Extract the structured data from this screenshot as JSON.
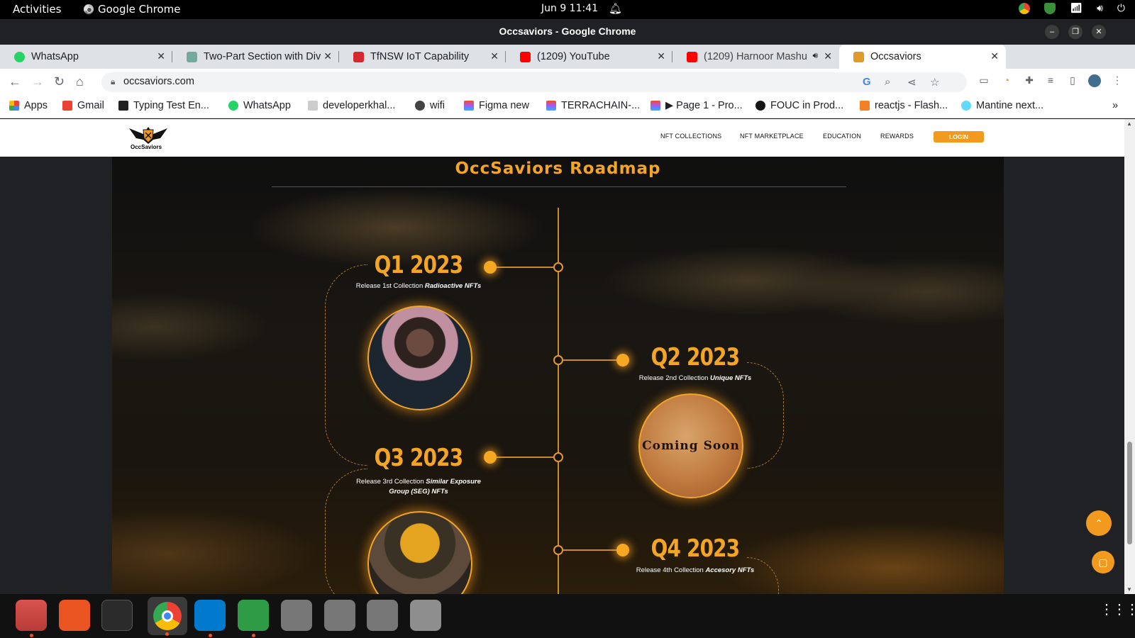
{
  "topbar": {
    "activities": "Activities",
    "app_name": "Google Chrome",
    "clock": "Jun 9  11:41"
  },
  "window": {
    "title": "Occsaviors - Google Chrome"
  },
  "tabs": [
    {
      "label": "WhatsApp",
      "color": "#25d366"
    },
    {
      "label": "Two-Part Section with Div",
      "color": "#74aa9c"
    },
    {
      "label": "TfNSW IoT Capability",
      "color": "#d7282f"
    },
    {
      "label": "(1209) YouTube",
      "color": "#ff0000"
    },
    {
      "label": "(1209) Harnoor Mashu",
      "color": "#ff0000"
    },
    {
      "label": "Occsaviors",
      "color": "#e09a2a"
    }
  ],
  "address": {
    "url": "occsaviors.com"
  },
  "bookmarks": [
    {
      "label": "Apps",
      "color": "#ea4335"
    },
    {
      "label": "Gmail",
      "color": "#ea4335"
    },
    {
      "label": "Typing Test En...",
      "color": "#222222"
    },
    {
      "label": "WhatsApp",
      "color": "#25d366"
    },
    {
      "label": "developerkhal...",
      "color": "#666666"
    },
    {
      "label": "wifi",
      "color": "#444444"
    },
    {
      "label": "Figma new",
      "color": "#f24e1e"
    },
    {
      "label": "TERRACHAIN-...",
      "color": "#f24e1e"
    },
    {
      "label": "▶ Page 1 - Pro...",
      "color": "#a259ff"
    },
    {
      "label": "FOUC in Prod...",
      "color": "#181717"
    },
    {
      "label": "reactjs - Flash...",
      "color": "#f48024"
    },
    {
      "label": "Mantine next...",
      "color": "#61dafb"
    }
  ],
  "site": {
    "logo_text": "OccSaviors",
    "nav": [
      "NFT COLLECTIONS",
      "NFT MARKETPLACE",
      "EDUCATION",
      "REWARDS"
    ],
    "login": "LOGIN",
    "heading": "OccSaviors Roadmap",
    "milestones": [
      {
        "quarter": "Q1 2023",
        "desc_plain": "Release 1st Collection ",
        "desc_bold": "Radioactive NFTs"
      },
      {
        "quarter": "Q2 2023",
        "desc_plain": "Release 2nd Collection ",
        "desc_bold": "Unique NFTs",
        "image_text": "Coming Soon"
      },
      {
        "quarter": "Q3 2023",
        "desc_plain": "Release 3rd Collection ",
        "desc_bold": "Similar Exposure Group (SEG) NFTs"
      },
      {
        "quarter": "Q4 2023",
        "desc_plain": "Release 4th Collection ",
        "desc_bold": "Accesory NFTs"
      }
    ]
  },
  "colors": {
    "accent": "#f5a524",
    "chrome_dark": "#202124"
  }
}
